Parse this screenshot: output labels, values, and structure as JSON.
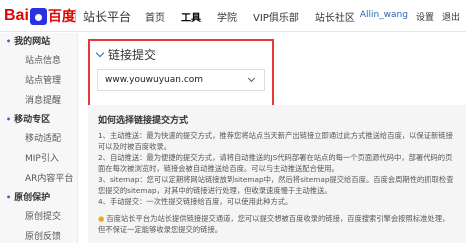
{
  "header": {
    "logo_bai": "Bai",
    "logo_du": "百度",
    "site_title": "站长平台",
    "nav": [
      "首页",
      "工具",
      "学院",
      "VIP俱乐部",
      "站长社区"
    ],
    "active_nav": "工具",
    "username": "Allin_wang",
    "settings": "设置",
    "logout": "退出"
  },
  "sidebar": {
    "groups": [
      {
        "label": "我的网站",
        "items": [
          "站点信息",
          "站点管理",
          "消息提醒"
        ]
      },
      {
        "label": "移动专区",
        "items": [
          "移动适配",
          "MIP引入",
          "AR内容平台"
        ]
      },
      {
        "label": "原创保护",
        "items": [
          "原创提交",
          "原创反馈"
        ]
      }
    ]
  },
  "submit": {
    "title": "链接提交",
    "site_value": "www.youwuyuan.com"
  },
  "help": {
    "title": "如何选择链接提交方式",
    "paragraphs": [
      "1、主动推送：最为快速的提交方式，推荐您将站点当天新产出链接立即通过此方式推送给百度，以保证新链接可以及时被百度收录。",
      "2、自动推送：最为便捷的提交方式，请将自动推送的JS代码部署在站点的每一个页面源代码中，部署代码的页面在每次被浏览时，链接会被自动推送给百度。可以与主动推送配合使用。",
      "3、sitemap：您可以定期将网站链接放到sitemap中，然后将sitemap提交给百度。百度会周期性的抓取检查您提交的sitemap，对其中的链接进行处理，但收录速度慢于主动推送。",
      "4、手动提交：一次性提交链接给百度，可以使用此种方式。"
    ],
    "tip": "百度站长平台为站长提供链接提交通道，您可以提交想被百度收录的链接，百度搜索引擎会按照标准处理，但不保证一定能够收录您提交的链接。"
  }
}
